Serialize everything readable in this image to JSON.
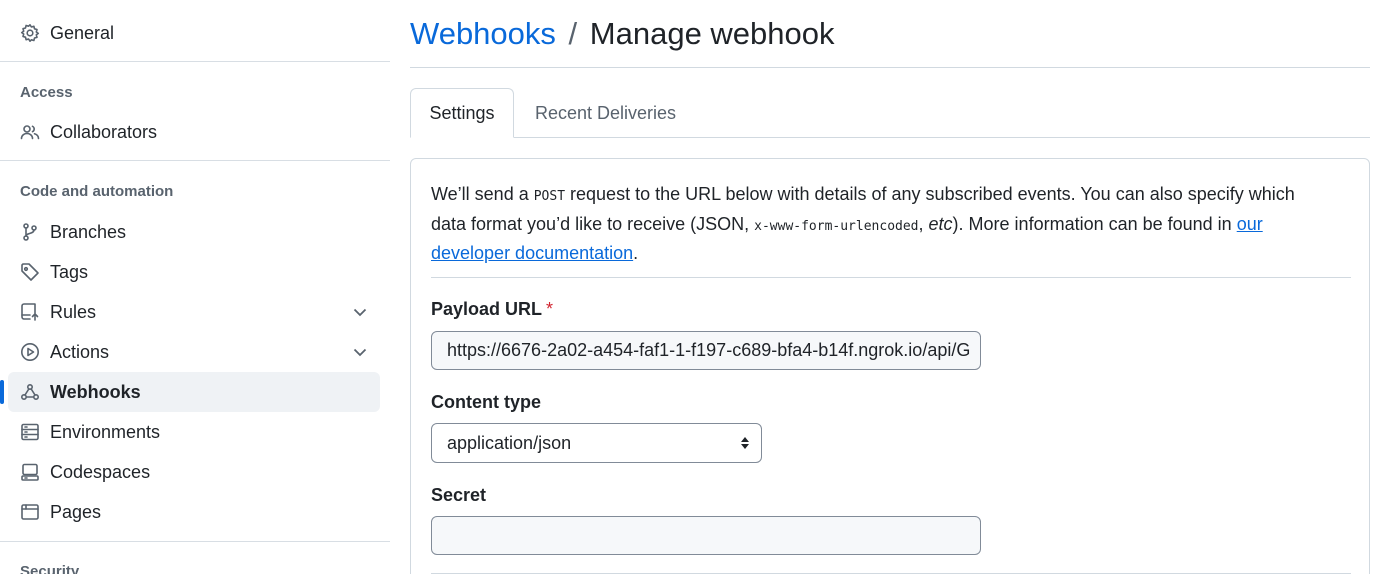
{
  "sidebar": {
    "general": "General",
    "access_title": "Access",
    "collaborators": "Collaborators",
    "code_title": "Code and automation",
    "branches": "Branches",
    "tags": "Tags",
    "rules": "Rules",
    "actions": "Actions",
    "webhooks": "Webhooks",
    "environments": "Environments",
    "codespaces": "Codespaces",
    "pages": "Pages",
    "security_title": "Security"
  },
  "header": {
    "breadcrumb": "Webhooks",
    "separator": "/",
    "title": "Manage webhook"
  },
  "tabs": {
    "settings": "Settings",
    "recent_deliveries": "Recent Deliveries"
  },
  "intro": {
    "part1": "We’ll send a ",
    "post": "POST",
    "part2": " request to the URL below with details of any subscribed events. You can also specify which data format you’d like to receive (JSON, ",
    "form_code": "x-www-form-urlencoded",
    "part3": ", ",
    "etc": "etc",
    "part4": "). More information can be found in ",
    "link": "our developer documentation",
    "part5": "."
  },
  "form": {
    "payload_label": "Payload URL",
    "required_mark": "*",
    "payload_value": "https://6676-2a02-a454-faf1-1-f197-c689-bfa4-b14f.ngrok.io/api/G",
    "content_type_label": "Content type",
    "content_type_value": "application/json",
    "secret_label": "Secret",
    "secret_value": ""
  },
  "colors": {
    "accent": "#0969da",
    "active_indicator": "#0969da",
    "required": "#d1242f"
  }
}
